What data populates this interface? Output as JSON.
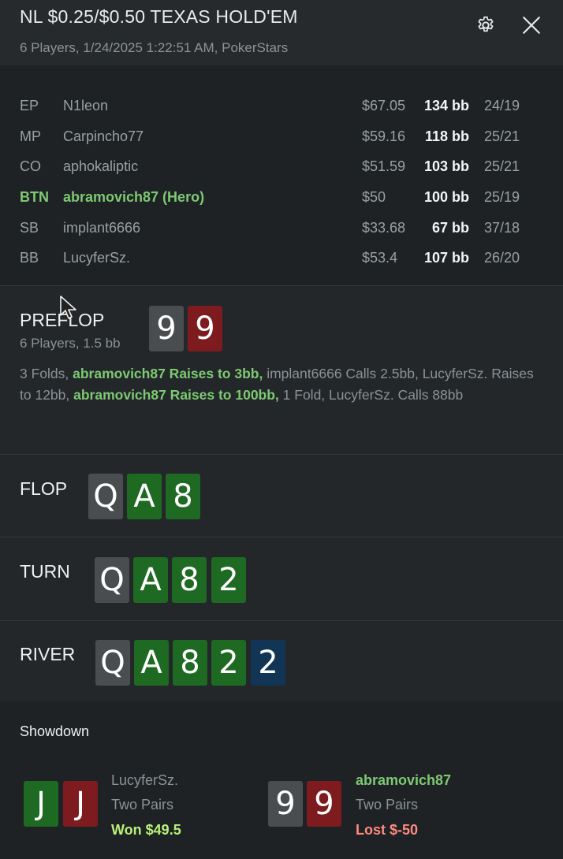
{
  "header": {
    "title": "NL $0.25/$0.50 TEXAS HOLD'EM",
    "subtitle": "6 Players, 1/24/2025 1:22:51 AM, PokerStars",
    "settings_icon": "gear-icon",
    "close_icon": "close-icon"
  },
  "players": [
    {
      "pos": "EP",
      "name": "N1leon",
      "stack": "$67.05",
      "bb": "134 bb",
      "stats": "24/19",
      "hero": false
    },
    {
      "pos": "MP",
      "name": "Carpincho77",
      "stack": "$59.16",
      "bb": "118 bb",
      "stats": "25/21",
      "hero": false
    },
    {
      "pos": "CO",
      "name": "aphokaliptic",
      "stack": "$51.59",
      "bb": "103 bb",
      "stats": "25/21",
      "hero": false
    },
    {
      "pos": "BTN",
      "name": "abramovich87 (Hero)",
      "stack": "$50",
      "bb": "100 bb",
      "stats": "25/19",
      "hero": true
    },
    {
      "pos": "SB",
      "name": "implant6666",
      "stack": "$33.68",
      "bb": "67 bb",
      "stats": "37/18",
      "hero": false
    },
    {
      "pos": "BB",
      "name": "LucyferSz.",
      "stack": "$53.4",
      "bb": "107 bb",
      "stats": "26/20",
      "hero": false
    }
  ],
  "preflop": {
    "label": "PREFLOP",
    "info": "6 Players, 1.5 bb",
    "hero_cards": [
      {
        "rank": "9",
        "color": "#4a4d50"
      },
      {
        "rank": "9",
        "color": "#7d1b1f"
      }
    ],
    "actions": [
      {
        "text": "3 Folds, ",
        "hero": false
      },
      {
        "text": "abramovich87 Raises to 3bb,",
        "hero": true
      },
      {
        "text": " implant6666 Calls 2.5bb, LucyferSz. Raises to 12bb, ",
        "hero": false
      },
      {
        "text": "abramovich87 Raises to 100bb,",
        "hero": true
      },
      {
        "text": " 1 Fold, LucyferSz. Calls 88bb",
        "hero": false
      }
    ]
  },
  "flop": {
    "label": "FLOP",
    "cards": [
      {
        "rank": "Q",
        "color": "#4a4d50"
      },
      {
        "rank": "A",
        "color": "#1e6a22"
      },
      {
        "rank": "8",
        "color": "#1e6a22"
      }
    ]
  },
  "turn": {
    "label": "TURN",
    "cards": [
      {
        "rank": "Q",
        "color": "#4a4d50"
      },
      {
        "rank": "A",
        "color": "#1e6a22"
      },
      {
        "rank": "8",
        "color": "#1e6a22"
      },
      {
        "rank": "2",
        "color": "#1e6a22"
      }
    ]
  },
  "river": {
    "label": "RIVER",
    "cards": [
      {
        "rank": "Q",
        "color": "#4a4d50"
      },
      {
        "rank": "A",
        "color": "#1e6a22"
      },
      {
        "rank": "8",
        "color": "#1e6a22"
      },
      {
        "rank": "2",
        "color": "#1e6a22"
      },
      {
        "rank": "2",
        "color": "#123556"
      }
    ]
  },
  "showdown": {
    "title": "Showdown",
    "hands": [
      {
        "player": "LucyferSz.",
        "hand": "Two Pairs",
        "result": "Won $49.5",
        "won": true,
        "hero": false,
        "cards": [
          {
            "rank": "J",
            "color": "#1e6a22"
          },
          {
            "rank": "J",
            "color": "#7d1b1f"
          }
        ]
      },
      {
        "player": "abramovich87",
        "hand": "Two Pairs",
        "result": "Lost $-50",
        "won": false,
        "hero": true,
        "cards": [
          {
            "rank": "9",
            "color": "#4a4d50"
          },
          {
            "rank": "9",
            "color": "#7d1b1f"
          }
        ]
      }
    ]
  },
  "colors": {
    "hero": "#7dc973",
    "won": "#b9f07a",
    "lost": "#ff8a7f",
    "card_gray": "#4a4d50",
    "card_red": "#7d1b1f",
    "card_green": "#1e6a22",
    "card_blue": "#123556"
  }
}
